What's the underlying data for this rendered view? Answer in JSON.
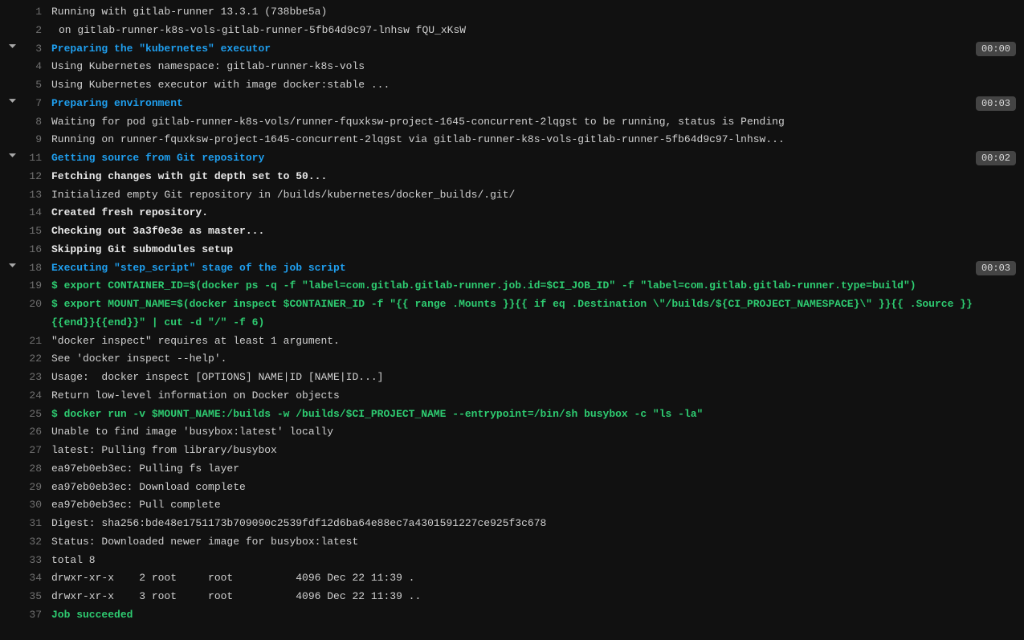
{
  "lines": [
    {
      "n": 1,
      "toggle": false,
      "style": "c-plain",
      "indent": false,
      "text": "Running with gitlab-runner 13.3.1 (738bbe5a)"
    },
    {
      "n": 2,
      "toggle": false,
      "style": "c-plain",
      "indent": true,
      "text": "on gitlab-runner-k8s-vols-gitlab-runner-5fb64d9c97-lnhsw fQU_xKsW"
    },
    {
      "n": 3,
      "toggle": true,
      "style": "c-blue-bold",
      "indent": false,
      "text": "Preparing the \"kubernetes\" executor",
      "timing": "00:00"
    },
    {
      "n": 4,
      "toggle": false,
      "style": "c-plain",
      "indent": false,
      "text": "Using Kubernetes namespace: gitlab-runner-k8s-vols"
    },
    {
      "n": 5,
      "toggle": false,
      "style": "c-plain",
      "indent": false,
      "text": "Using Kubernetes executor with image docker:stable ..."
    },
    {
      "n": 7,
      "toggle": true,
      "style": "c-blue-bold",
      "indent": false,
      "text": "Preparing environment",
      "timing": "00:03"
    },
    {
      "n": 8,
      "toggle": false,
      "style": "c-plain",
      "indent": false,
      "text": "Waiting for pod gitlab-runner-k8s-vols/runner-fquxksw-project-1645-concurrent-2lqgst to be running, status is Pending"
    },
    {
      "n": 9,
      "toggle": false,
      "style": "c-plain",
      "indent": false,
      "text": "Running on runner-fquxksw-project-1645-concurrent-2lqgst via gitlab-runner-k8s-vols-gitlab-runner-5fb64d9c97-lnhsw..."
    },
    {
      "n": 11,
      "toggle": true,
      "style": "c-blue-bold",
      "indent": false,
      "text": "Getting source from Git repository",
      "timing": "00:02"
    },
    {
      "n": 12,
      "toggle": false,
      "style": "c-white-bold",
      "indent": false,
      "text": "Fetching changes with git depth set to 50..."
    },
    {
      "n": 13,
      "toggle": false,
      "style": "c-plain",
      "indent": false,
      "text": "Initialized empty Git repository in /builds/kubernetes/docker_builds/.git/"
    },
    {
      "n": 14,
      "toggle": false,
      "style": "c-white-bold",
      "indent": false,
      "text": "Created fresh repository."
    },
    {
      "n": 15,
      "toggle": false,
      "style": "c-white-bold",
      "indent": false,
      "text": "Checking out 3a3f0e3e as master..."
    },
    {
      "n": 16,
      "toggle": false,
      "style": "c-white-bold",
      "indent": false,
      "text": "Skipping Git submodules setup"
    },
    {
      "n": 18,
      "toggle": true,
      "style": "c-blue-bold",
      "indent": false,
      "text": "Executing \"step_script\" stage of the job script",
      "timing": "00:03"
    },
    {
      "n": 19,
      "toggle": false,
      "style": "c-green-bold",
      "indent": false,
      "text": "$ export CONTAINER_ID=$(docker ps -q -f \"label=com.gitlab.gitlab-runner.job.id=$CI_JOB_ID\" -f \"label=com.gitlab.gitlab-runner.type=build\")"
    },
    {
      "n": 20,
      "toggle": false,
      "style": "c-green-bold",
      "indent": false,
      "text": "$ export MOUNT_NAME=$(docker inspect $CONTAINER_ID -f \"{{ range .Mounts }}{{ if eq .Destination \\\"/builds/${CI_PROJECT_NAMESPACE}\\\" }}{{ .Source }}{{end}}{{end}}\" | cut -d \"/\" -f 6)"
    },
    {
      "n": 21,
      "toggle": false,
      "style": "c-plain",
      "indent": false,
      "text": "\"docker inspect\" requires at least 1 argument."
    },
    {
      "n": 22,
      "toggle": false,
      "style": "c-plain",
      "indent": false,
      "text": "See 'docker inspect --help'."
    },
    {
      "n": 23,
      "toggle": false,
      "style": "c-plain",
      "indent": false,
      "text": "Usage:  docker inspect [OPTIONS] NAME|ID [NAME|ID...]"
    },
    {
      "n": 24,
      "toggle": false,
      "style": "c-plain",
      "indent": false,
      "text": "Return low-level information on Docker objects"
    },
    {
      "n": 25,
      "toggle": false,
      "style": "c-green-bold",
      "indent": false,
      "text": "$ docker run -v $MOUNT_NAME:/builds -w /builds/$CI_PROJECT_NAME --entrypoint=/bin/sh busybox -c \"ls -la\""
    },
    {
      "n": 26,
      "toggle": false,
      "style": "c-plain",
      "indent": false,
      "text": "Unable to find image 'busybox:latest' locally"
    },
    {
      "n": 27,
      "toggle": false,
      "style": "c-plain",
      "indent": false,
      "text": "latest: Pulling from library/busybox"
    },
    {
      "n": 28,
      "toggle": false,
      "style": "c-plain",
      "indent": false,
      "text": "ea97eb0eb3ec: Pulling fs layer"
    },
    {
      "n": 29,
      "toggle": false,
      "style": "c-plain",
      "indent": false,
      "text": "ea97eb0eb3ec: Download complete"
    },
    {
      "n": 30,
      "toggle": false,
      "style": "c-plain",
      "indent": false,
      "text": "ea97eb0eb3ec: Pull complete"
    },
    {
      "n": 31,
      "toggle": false,
      "style": "c-plain",
      "indent": false,
      "text": "Digest: sha256:bde48e1751173b709090c2539fdf12d6ba64e88ec7a4301591227ce925f3c678"
    },
    {
      "n": 32,
      "toggle": false,
      "style": "c-plain",
      "indent": false,
      "text": "Status: Downloaded newer image for busybox:latest"
    },
    {
      "n": 33,
      "toggle": false,
      "style": "c-plain",
      "indent": false,
      "text": "total 8"
    },
    {
      "n": 34,
      "toggle": false,
      "style": "c-plain",
      "indent": false,
      "text": "drwxr-xr-x    2 root     root          4096 Dec 22 11:39 ."
    },
    {
      "n": 35,
      "toggle": false,
      "style": "c-plain",
      "indent": false,
      "text": "drwxr-xr-x    3 root     root          4096 Dec 22 11:39 .."
    },
    {
      "n": 37,
      "toggle": false,
      "style": "c-green-bold",
      "indent": false,
      "text": "Job succeeded"
    }
  ]
}
